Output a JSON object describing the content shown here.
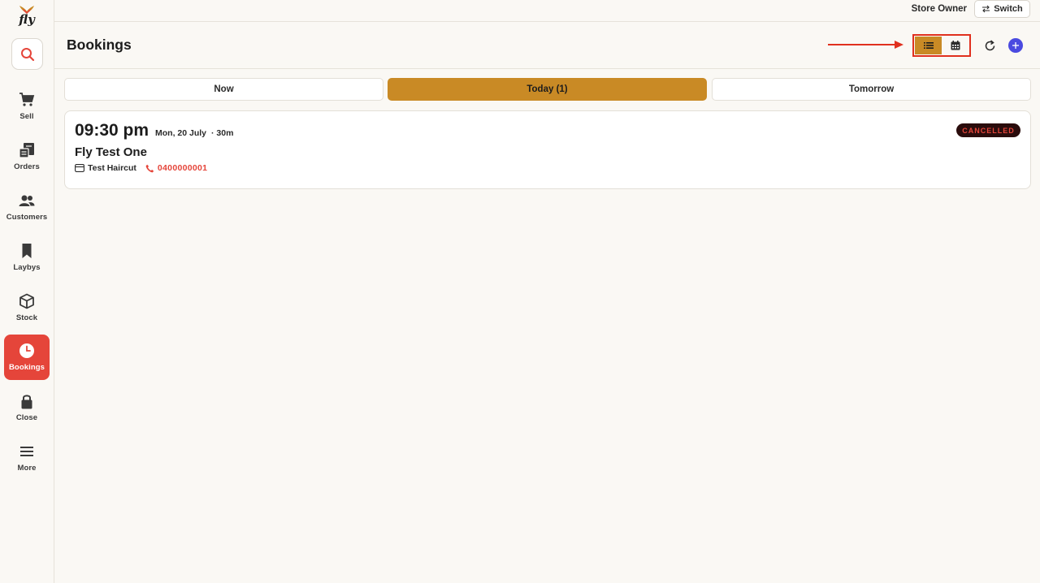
{
  "app": {
    "logo_text": "fly"
  },
  "sidebar": {
    "items": [
      {
        "label": "Sell",
        "icon": "cart-icon"
      },
      {
        "label": "Orders",
        "icon": "orders-icon"
      },
      {
        "label": "Customers",
        "icon": "customers-icon"
      },
      {
        "label": "Laybys",
        "icon": "bookmark-icon"
      },
      {
        "label": "Stock",
        "icon": "box-icon"
      },
      {
        "label": "Bookings",
        "icon": "clock-icon",
        "active": true
      },
      {
        "label": "Close",
        "icon": "lock-icon"
      },
      {
        "label": "More",
        "icon": "menu-icon"
      }
    ]
  },
  "topbar": {
    "user_role": "Store Owner",
    "switch_label": "Switch"
  },
  "header": {
    "title": "Bookings",
    "view_mode": "list"
  },
  "tabs": [
    {
      "label": "Now",
      "active": false
    },
    {
      "label": "Today (1)",
      "active": true
    },
    {
      "label": "Tomorrow",
      "active": false
    }
  ],
  "bookings": [
    {
      "time": "09:30 pm",
      "date": "Mon, 20 July",
      "duration": "· 30m",
      "customer": "Fly Test One",
      "service": "Test Haircut",
      "phone": "0400000001",
      "status": "CANCELLED"
    }
  ],
  "colors": {
    "accent_red": "#e5453a",
    "tab_active": "#c98a25",
    "add_button": "#4a4ae0",
    "highlight_box": "#e0301e"
  }
}
